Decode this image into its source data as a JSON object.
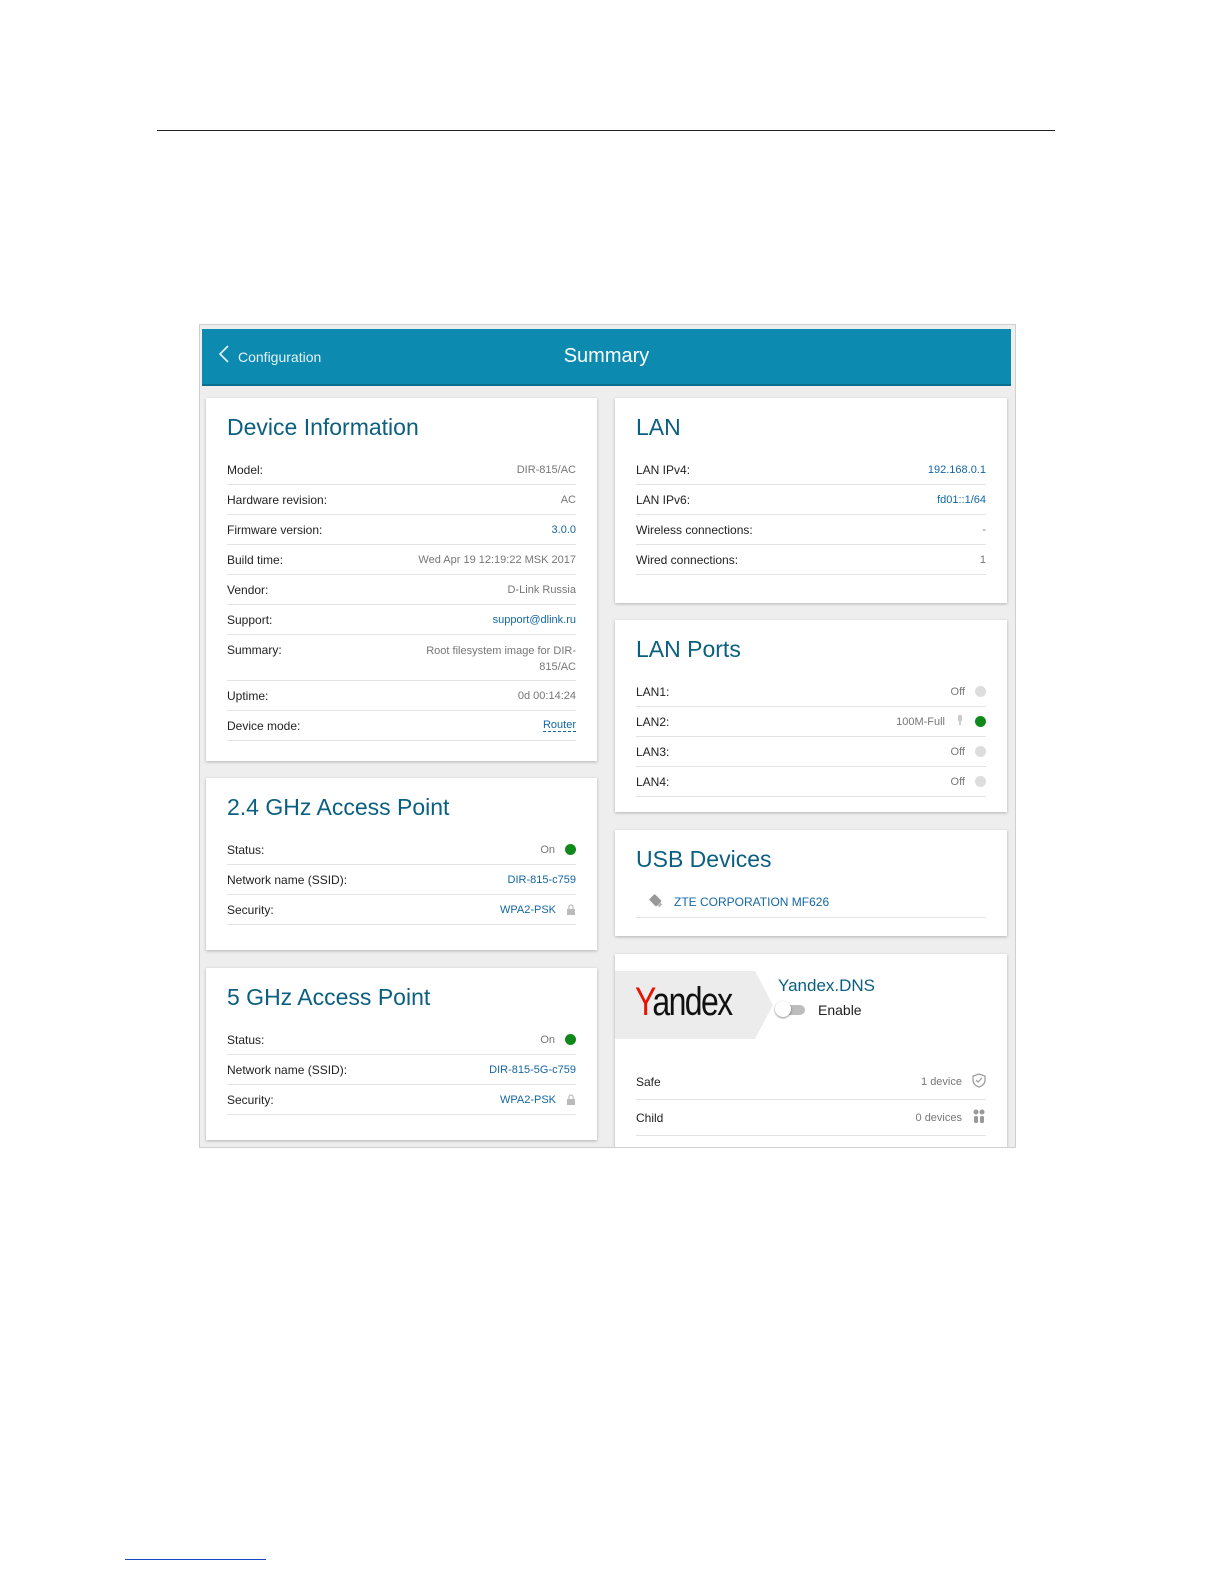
{
  "header": {
    "back_label": "Configuration",
    "title": "Summary"
  },
  "device_info": {
    "title": "Device Information",
    "rows": [
      {
        "key": "Model:",
        "value": "DIR-815/AC"
      },
      {
        "key": "Hardware revision:",
        "value": "AC"
      },
      {
        "key": "Firmware version:",
        "value": "3.0.0"
      },
      {
        "key": "Build time:",
        "value": "Wed Apr 19 12:19:22 MSK 2017"
      },
      {
        "key": "Vendor:",
        "value": "D-Link Russia"
      },
      {
        "key": "Support:",
        "value": "support@dlink.ru"
      },
      {
        "key": "Summary:",
        "value": "Root filesystem image for DIR-815/AC"
      },
      {
        "key": "Uptime:",
        "value": "0d 00:14:24"
      },
      {
        "key": "Device mode:",
        "value": "Router"
      }
    ]
  },
  "ap24": {
    "title": "2.4 GHz Access Point",
    "status_key": "Status:",
    "status_value": "On",
    "ssid_key": "Network name (SSID):",
    "ssid_value": "DIR-815-c759",
    "security_key": "Security:",
    "security_value": "WPA2-PSK"
  },
  "ap5": {
    "title": "5 GHz Access Point",
    "status_key": "Status:",
    "status_value": "On",
    "ssid_key": "Network name (SSID):",
    "ssid_value": "DIR-815-5G-c759",
    "security_key": "Security:",
    "security_value": "WPA2-PSK"
  },
  "lan": {
    "title": "LAN",
    "rows": [
      {
        "key": "LAN IPv4:",
        "value": "192.168.0.1"
      },
      {
        "key": "LAN IPv6:",
        "value": "fd01::1/64"
      },
      {
        "key": "Wireless connections:",
        "value": "-"
      },
      {
        "key": "Wired connections:",
        "value": "1"
      }
    ]
  },
  "lan_ports": {
    "title": "LAN Ports",
    "rows": [
      {
        "key": "LAN1:",
        "value": "Off"
      },
      {
        "key": "LAN2:",
        "value": "100M-Full"
      },
      {
        "key": "LAN3:",
        "value": "Off"
      },
      {
        "key": "LAN4:",
        "value": "Off"
      }
    ]
  },
  "usb": {
    "title": "USB Devices",
    "device": "ZTE CORPORATION MF626"
  },
  "yandex": {
    "logo_first": "Y",
    "logo_rest": "andex",
    "title": "Yandex.DNS",
    "enable_label": "Enable",
    "rows": [
      {
        "key": "Safe",
        "value": "1 device"
      },
      {
        "key": "Child",
        "value": "0 devices"
      }
    ]
  },
  "colors": {
    "header": "#0d8aaf",
    "title": "#0b5f80",
    "link": "#1466a5",
    "status_on": "#0f8a1a",
    "status_off": "#dddddd"
  }
}
